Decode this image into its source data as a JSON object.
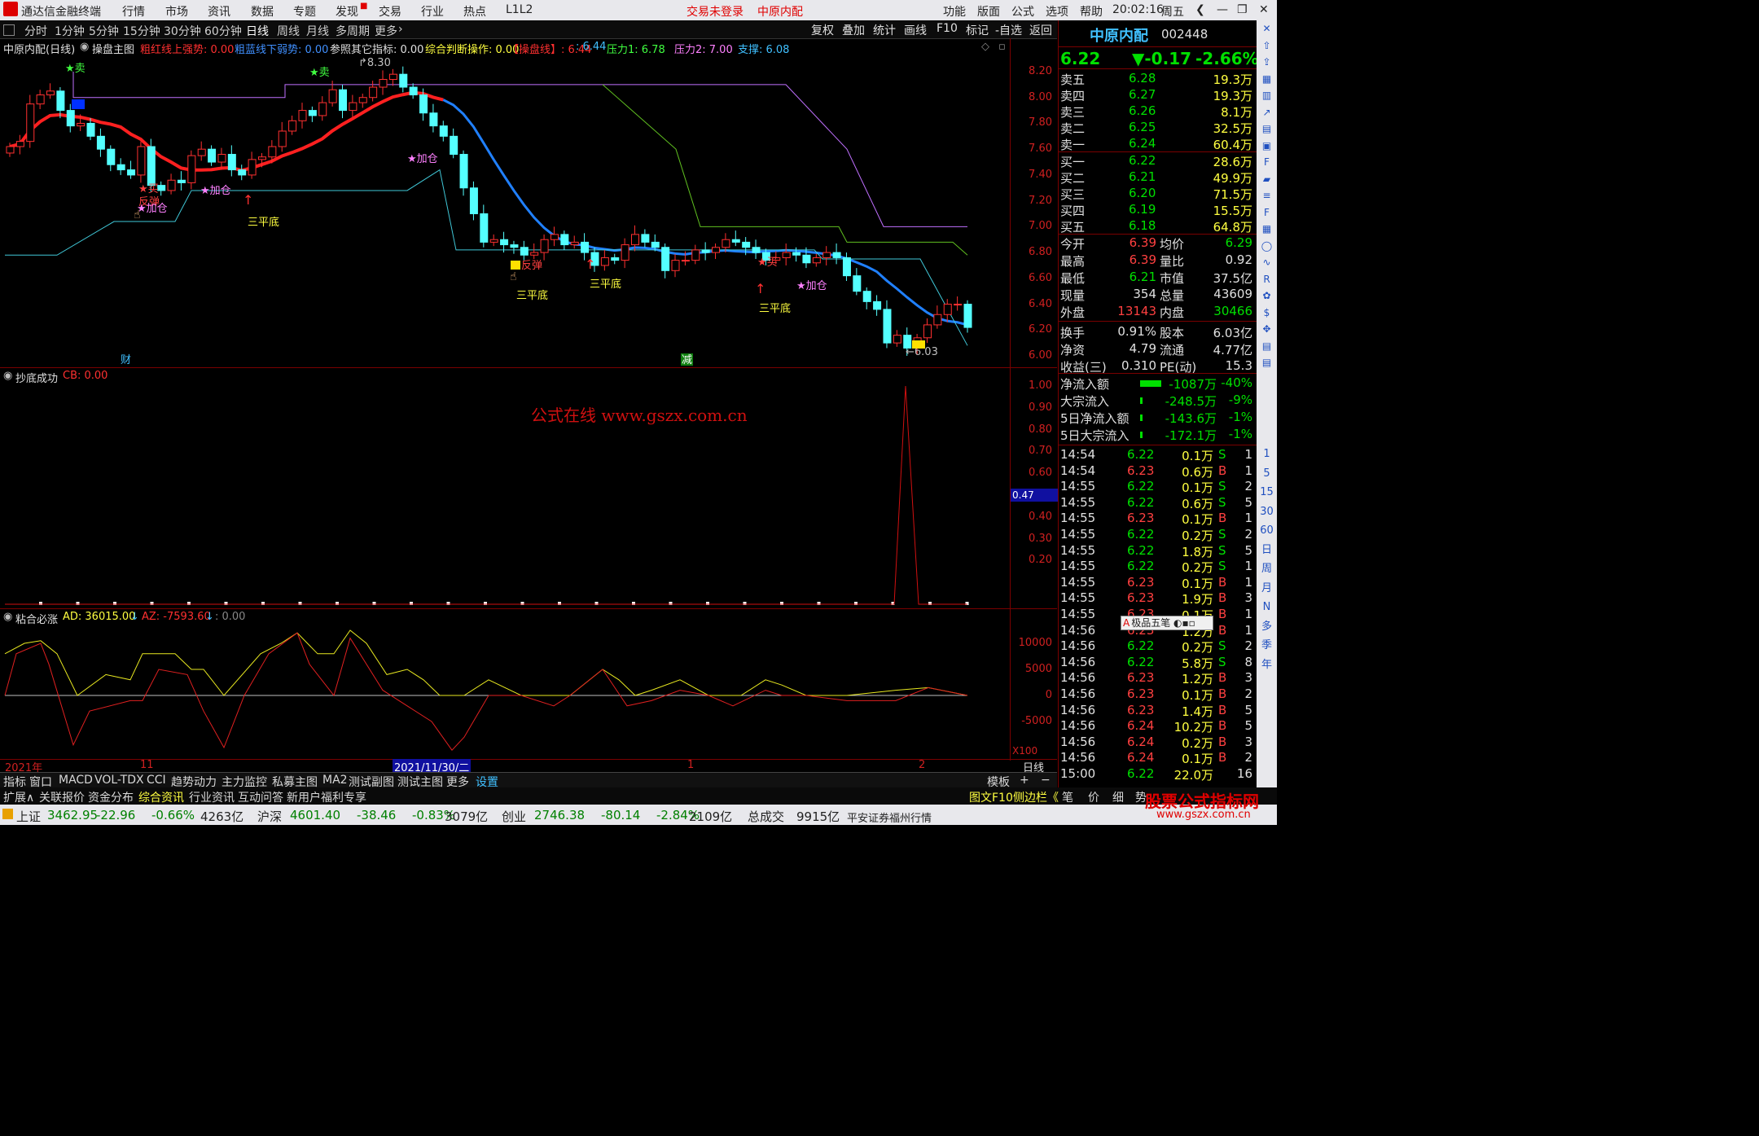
{
  "titlebar": {
    "app_name": "通达信金融终端",
    "menu": [
      "行情",
      "市场",
      "资讯",
      "数据",
      "专题",
      "发现",
      "交易",
      "行业",
      "热点",
      "L1L2"
    ],
    "status_login": "交易未登录",
    "stock_name": "中原内配",
    "right_menu": [
      "功能",
      "版面",
      "公式",
      "选项",
      "帮助"
    ],
    "time": "20:02:16",
    "weekday": "周五"
  },
  "periodbar": {
    "items": [
      "分时",
      "1分钟",
      "5分钟",
      "15分钟",
      "30分钟",
      "60分钟",
      "日线",
      "周线",
      "月线",
      "多周期",
      "更多"
    ],
    "active": "日线",
    "right_buttons": [
      "复权",
      "叠加",
      "统计",
      "画线",
      "F10",
      "标记",
      "-自选",
      "返回"
    ]
  },
  "main_chart": {
    "header_name": "中原内配(日线)",
    "indicator_name": "操盘主图",
    "items": [
      {
        "label": "粗红线上强势: 0.00",
        "color": "#ff3030"
      },
      {
        "label": "粗蓝线下弱势: 0.00",
        "color": "#4090ff"
      },
      {
        "label": "参照其它指标: 0.00",
        "color": "#e0e0e0"
      },
      {
        "label": "综合判断操作: 0.00",
        "color": "#ffff40"
      },
      {
        "label": "【操盘线】: 6.44",
        "color": "#ff3030"
      },
      {
        "label": ": 6.44",
        "color": "#40c0ff"
      },
      {
        "label": "压力1: 6.78",
        "color": "#40ff40"
      },
      {
        "label": "压力2: 7.00",
        "color": "#ff80ff"
      },
      {
        "label": "支撑: 6.08",
        "color": "#40c0ff"
      }
    ],
    "y_ticks": [
      "8.20",
      "8.00",
      "7.80",
      "7.60",
      "7.40",
      "7.20",
      "7.00",
      "6.80",
      "6.60",
      "6.40",
      "6.20",
      "6.00"
    ],
    "high_label": "8.30",
    "low_label": "6.03",
    "annotations": {
      "sell": "卖",
      "buy": "买",
      "add": "加仓",
      "rebound": "反弹",
      "three_bottom": "三平底",
      "cai": "财",
      "jian": "减"
    }
  },
  "panel2": {
    "name": "抄底成功",
    "item": "CB: 0.00",
    "y_ticks": [
      "1.00",
      "0.90",
      "0.80",
      "0.70",
      "0.60",
      "0.50",
      "0.40",
      "0.30",
      "0.20"
    ],
    "current_value": "0.47",
    "watermark": "公式在线  www.gszx.com.cn"
  },
  "panel3": {
    "name": "粘合必涨",
    "ad": "AD: 36015.00",
    "az": "AZ: -7593.60",
    "extra": ": 0.00",
    "y_ticks": [
      "10000",
      "5000",
      "0",
      "-5000"
    ],
    "scale": "X100"
  },
  "xaxis": {
    "labels": [
      "2021年",
      "11",
      "2021/11/30/二",
      "1",
      "2"
    ],
    "period": "日线"
  },
  "tabs": [
    "指标",
    "窗口",
    "MACD",
    "VOL-TDX",
    "CCI",
    "趋势动力",
    "主力监控",
    "私募主图",
    "MA2",
    "测试副图",
    "测试主图",
    "更多",
    "设置"
  ],
  "tabs_right": [
    "模板",
    "+",
    "−"
  ],
  "extbar": [
    "扩展∧",
    "关联报价",
    "资金分布",
    "综合资讯",
    "行业资讯",
    "互动问答",
    "新用户福利专享"
  ],
  "extbar_right": [
    "图文F10",
    "侧边栏《",
    "笔",
    "价",
    "细",
    "势"
  ],
  "right_panel": {
    "name": "中原内配",
    "code": "002448",
    "price": "6.22",
    "change": "▼-0.17",
    "change_pct": "-2.66%",
    "asks": [
      {
        "label": "卖五",
        "price": "6.28",
        "vol": "19.3万"
      },
      {
        "label": "卖四",
        "price": "6.27",
        "vol": "19.3万"
      },
      {
        "label": "卖三",
        "price": "6.26",
        "vol": "8.1万"
      },
      {
        "label": "卖二",
        "price": "6.25",
        "vol": "32.5万"
      },
      {
        "label": "卖一",
        "price": "6.24",
        "vol": "60.4万"
      }
    ],
    "bids": [
      {
        "label": "买一",
        "price": "6.22",
        "vol": "28.6万"
      },
      {
        "label": "买二",
        "price": "6.21",
        "vol": "49.9万"
      },
      {
        "label": "买三",
        "price": "6.20",
        "vol": "71.5万"
      },
      {
        "label": "买四",
        "price": "6.19",
        "vol": "15.5万"
      },
      {
        "label": "买五",
        "price": "6.18",
        "vol": "64.8万"
      }
    ],
    "stats": [
      {
        "k1": "今开",
        "v1": "6.39",
        "k2": "均价",
        "v2": "6.29"
      },
      {
        "k1": "最高",
        "v1": "6.39",
        "k2": "量比",
        "v2": "0.92"
      },
      {
        "k1": "最低",
        "v1": "6.21",
        "k2": "市值",
        "v2": "37.5亿"
      },
      {
        "k1": "现量",
        "v1": "354",
        "k2": "总量",
        "v2": "43609"
      },
      {
        "k1": "外盘",
        "v1": "13143",
        "k2": "内盘",
        "v2": "30466"
      },
      {
        "k1": "换手",
        "v1": "0.91%",
        "k2": "股本",
        "v2": "6.03亿"
      },
      {
        "k1": "净资",
        "v1": "4.79",
        "k2": "流通",
        "v2": "4.77亿"
      },
      {
        "k1": "收益(三)",
        "v1": "0.310",
        "k2": "PE(动)",
        "v2": "15.3"
      }
    ],
    "flows": [
      {
        "k": "净流入额",
        "v": "-1087万",
        "p": "-40%"
      },
      {
        "k": "大宗流入",
        "v": "-248.5万",
        "p": "-9%"
      },
      {
        "k": "5日净流入额",
        "v": "-143.6万",
        "p": "-1%"
      },
      {
        "k": "5日大宗流入",
        "v": "-172.1万",
        "p": "-1%"
      }
    ],
    "ticks": [
      {
        "t": "14:54",
        "p": "6.22",
        "v": "0.1万",
        "s": "S",
        "n": "1"
      },
      {
        "t": "14:54",
        "p": "6.23",
        "v": "0.6万",
        "s": "B",
        "n": "1"
      },
      {
        "t": "14:55",
        "p": "6.22",
        "v": "0.1万",
        "s": "S",
        "n": "2"
      },
      {
        "t": "14:55",
        "p": "6.22",
        "v": "0.6万",
        "s": "S",
        "n": "5"
      },
      {
        "t": "14:55",
        "p": "6.23",
        "v": "0.1万",
        "s": "B",
        "n": "1"
      },
      {
        "t": "14:55",
        "p": "6.22",
        "v": "0.2万",
        "s": "S",
        "n": "2"
      },
      {
        "t": "14:55",
        "p": "6.22",
        "v": "1.8万",
        "s": "S",
        "n": "5"
      },
      {
        "t": "14:55",
        "p": "6.22",
        "v": "0.2万",
        "s": "S",
        "n": "1"
      },
      {
        "t": "14:55",
        "p": "6.23",
        "v": "0.1万",
        "s": "B",
        "n": "1"
      },
      {
        "t": "14:55",
        "p": "6.23",
        "v": "1.9万",
        "s": "B",
        "n": "3"
      },
      {
        "t": "14:55",
        "p": "6.23",
        "v": "0.1万",
        "s": "B",
        "n": "1"
      },
      {
        "t": "14:56",
        "p": "6.23",
        "v": "1.2万",
        "s": "B",
        "n": "1"
      },
      {
        "t": "14:56",
        "p": "6.22",
        "v": "0.2万",
        "s": "S",
        "n": "2"
      },
      {
        "t": "14:56",
        "p": "6.22",
        "v": "5.8万",
        "s": "S",
        "n": "8"
      },
      {
        "t": "14:56",
        "p": "6.23",
        "v": "1.2万",
        "s": "B",
        "n": "3"
      },
      {
        "t": "14:56",
        "p": "6.23",
        "v": "0.1万",
        "s": "B",
        "n": "2"
      },
      {
        "t": "14:56",
        "p": "6.23",
        "v": "1.4万",
        "s": "B",
        "n": "5"
      },
      {
        "t": "14:56",
        "p": "6.24",
        "v": "10.2万",
        "s": "B",
        "n": "5"
      },
      {
        "t": "14:56",
        "p": "6.24",
        "v": "0.2万",
        "s": "B",
        "n": "3"
      },
      {
        "t": "14:56",
        "p": "6.24",
        "v": "0.1万",
        "s": "B",
        "n": "2"
      },
      {
        "t": "15:00",
        "p": "6.22",
        "v": "22.0万",
        "s": "",
        "n": "16"
      }
    ],
    "popup": "极品五笔"
  },
  "side_icons": [
    "close-icon",
    "arrow-up-icon",
    "arrow-up-outline-icon",
    "bar-chart-icon",
    "grid-icon",
    "trend-icon",
    "calendar-icon",
    "doc-icon",
    "f10-icon",
    "flag-icon",
    "list-icon",
    "f2-icon",
    "table-icon",
    "circle-icon",
    "wave-icon",
    "rsi-icon",
    "gear-icon",
    "money-icon",
    "arrows-icon",
    "doc2-icon",
    "doc3-icon"
  ],
  "side_labels": [
    "1",
    "5",
    "15",
    "30",
    "60",
    "日",
    "周",
    "月",
    "N",
    "多",
    "季",
    "年"
  ],
  "statusbar": {
    "items": [
      {
        "name": "上证",
        "val": "3462.95",
        "chg": "-22.96",
        "pct": "-0.66%",
        "amt": "4263亿"
      },
      {
        "name": "沪深",
        "val": "4601.40",
        "chg": "-38.46",
        "pct": "-0.83%",
        "amt": "3079亿"
      },
      {
        "name": "创业",
        "val": "2746.38",
        "chg": "-80.14",
        "pct": "-2.84%",
        "amt": "2109亿"
      }
    ],
    "total_label": "总成交",
    "total_val": "9915亿",
    "broker": "平安证券福州行情",
    "site_logo": "股票公式指标网",
    "site_url": "www.gszx.com.cn"
  }
}
